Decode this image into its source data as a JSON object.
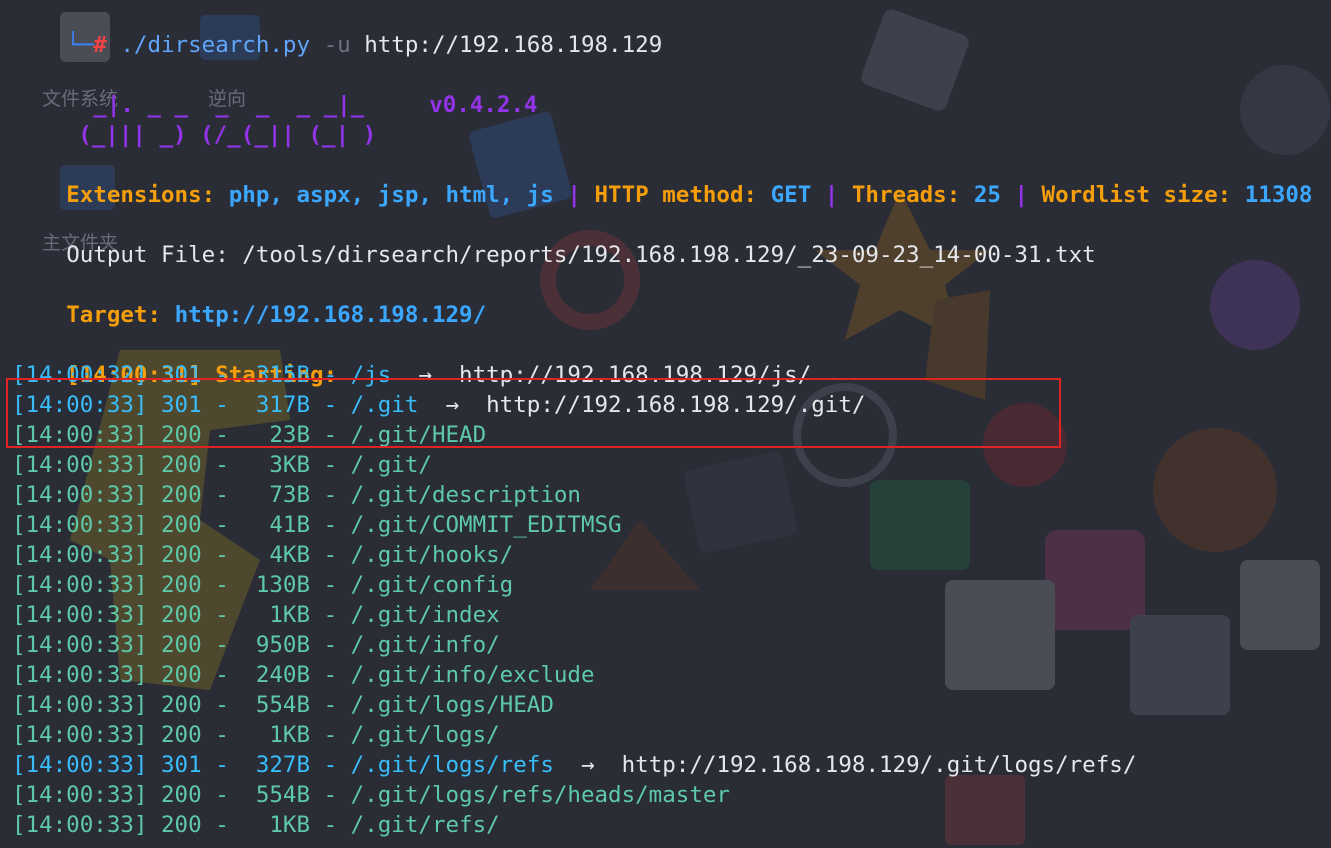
{
  "prompt": {
    "corner": "└─",
    "hash": "#",
    "command": "./dirsearch.py",
    "flag": "-u",
    "argument": "http://192.168.198.129"
  },
  "banner": {
    "art_line1": "  _|. _ _  _  _  _ _|_",
    "art_line2": "(_||| _) (/_(_|| (_| )",
    "version": "v0.4.2.4"
  },
  "config": {
    "extensions_label": "Extensions:",
    "extensions_value": "php, aspx, jsp, html, js",
    "sep": "|",
    "method_label": "HTTP method:",
    "method_value": "GET",
    "threads_label": "Threads:",
    "threads_value": "25",
    "wordlist_label": "Wordlist size:",
    "wordlist_value": "11308"
  },
  "output_file": "Output File: /tools/dirsearch/reports/192.168.198.129/_23-09-23_14-00-31.txt",
  "target": {
    "label": "Target:",
    "value": "http://192.168.198.129/"
  },
  "starting": {
    "time": "[14:00:31]",
    "label": "Starting:"
  },
  "results": [
    {
      "time": "[14:00:32]",
      "status": "301",
      "size": "315B",
      "path": "/js",
      "redirect": "http://192.168.198.129/js/"
    },
    {
      "time": "[14:00:33]",
      "status": "301",
      "size": "317B",
      "path": "/.git",
      "redirect": "http://192.168.198.129/.git/"
    },
    {
      "time": "[14:00:33]",
      "status": "200",
      "size": "23B",
      "path": "/.git/HEAD",
      "redirect": ""
    },
    {
      "time": "[14:00:33]",
      "status": "200",
      "size": "3KB",
      "path": "/.git/",
      "redirect": ""
    },
    {
      "time": "[14:00:33]",
      "status": "200",
      "size": "73B",
      "path": "/.git/description",
      "redirect": ""
    },
    {
      "time": "[14:00:33]",
      "status": "200",
      "size": "41B",
      "path": "/.git/COMMIT_EDITMSG",
      "redirect": ""
    },
    {
      "time": "[14:00:33]",
      "status": "200",
      "size": "4KB",
      "path": "/.git/hooks/",
      "redirect": ""
    },
    {
      "time": "[14:00:33]",
      "status": "200",
      "size": "130B",
      "path": "/.git/config",
      "redirect": ""
    },
    {
      "time": "[14:00:33]",
      "status": "200",
      "size": "1KB",
      "path": "/.git/index",
      "redirect": ""
    },
    {
      "time": "[14:00:33]",
      "status": "200",
      "size": "950B",
      "path": "/.git/info/",
      "redirect": ""
    },
    {
      "time": "[14:00:33]",
      "status": "200",
      "size": "240B",
      "path": "/.git/info/exclude",
      "redirect": ""
    },
    {
      "time": "[14:00:33]",
      "status": "200",
      "size": "554B",
      "path": "/.git/logs/HEAD",
      "redirect": ""
    },
    {
      "time": "[14:00:33]",
      "status": "200",
      "size": "1KB",
      "path": "/.git/logs/",
      "redirect": ""
    },
    {
      "time": "[14:00:33]",
      "status": "301",
      "size": "327B",
      "path": "/.git/logs/refs",
      "redirect": "http://192.168.198.129/.git/logs/refs/"
    },
    {
      "time": "[14:00:33]",
      "status": "200",
      "size": "554B",
      "path": "/.git/logs/refs/heads/master",
      "redirect": ""
    },
    {
      "time": "[14:00:33]",
      "status": "200",
      "size": "1KB",
      "path": "/.git/refs/",
      "redirect": ""
    }
  ],
  "arrow": "→",
  "dash": "-",
  "desktop_labels": {
    "filesystem": "文件系统",
    "reverse": "逆向",
    "home_folder": "主文件夹"
  },
  "colors": {
    "highlight_box": "#e02424",
    "ok_status": "#5ec9a8",
    "redirect_status": "#38bdf8",
    "label_orange": "#f59e0b",
    "value_blue": "#3ba7ff",
    "banner_purple": "#9333ea"
  }
}
